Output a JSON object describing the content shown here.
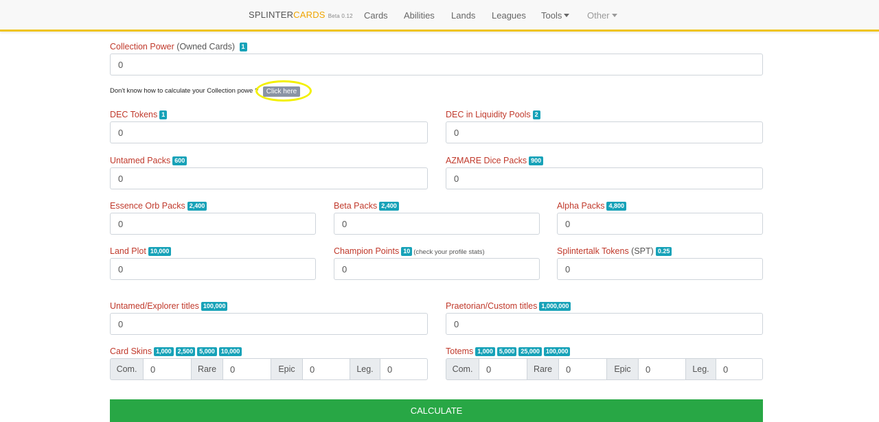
{
  "navbar": {
    "brand_part1": "SPLINTER",
    "brand_part2": "CARDS",
    "brand_beta": "Beta 0.12",
    "items": [
      "Cards",
      "Abilities",
      "Lands",
      "Leagues",
      "Tools",
      "Other"
    ]
  },
  "collection_power": {
    "label": "Collection Power",
    "sub": "(Owned Cards)",
    "badge": "1",
    "value": "0"
  },
  "help": {
    "text": "Don't know how to calculate your Collection powe",
    "mark": "?",
    "button": "Click here"
  },
  "dec_tokens": {
    "label": "DEC Tokens",
    "badge": "1",
    "value": "0"
  },
  "dec_liquidity": {
    "label": "DEC in Liquidity Pools",
    "badge": "2",
    "value": "0"
  },
  "untamed_packs": {
    "label": "Untamed Packs",
    "badge": "600",
    "value": "0"
  },
  "azmare_packs": {
    "label": "AZMARE Dice Packs",
    "badge": "900",
    "value": "0"
  },
  "essence_packs": {
    "label": "Essence Orb Packs",
    "badge": "2,400",
    "value": "0"
  },
  "beta_packs": {
    "label": "Beta Packs",
    "badge": "2,400",
    "value": "0"
  },
  "alpha_packs": {
    "label": "Alpha Packs",
    "badge": "4,800",
    "value": "0"
  },
  "land_plot": {
    "label": "Land Plot",
    "badge": "10,000",
    "value": "0"
  },
  "champion_points": {
    "label": "Champion Points",
    "badge": "10",
    "hint": "(check your profile stats)",
    "value": "0"
  },
  "spt": {
    "label": "Splintertalk Tokens",
    "sub": "(SPT)",
    "badge": "0.25",
    "value": "0"
  },
  "untamed_titles": {
    "label": "Untamed/Explorer titles",
    "badge": "100,000",
    "value": "0"
  },
  "praetorian_titles": {
    "label": "Praetorian/Custom titles",
    "badge": "1,000,000",
    "value": "0"
  },
  "card_skins": {
    "label": "Card Skins",
    "badges": [
      "1,000",
      "2,500",
      "5,000",
      "10,000"
    ],
    "addons": [
      "Com.",
      "Rare",
      "Epic",
      "Leg."
    ],
    "values": [
      "0",
      "0",
      "0",
      "0"
    ]
  },
  "totems": {
    "label": "Totems",
    "badges": [
      "1,000",
      "5,000",
      "25,000",
      "100,000"
    ],
    "addons": [
      "Com.",
      "Rare",
      "Epic",
      "Leg."
    ],
    "values": [
      "0",
      "0",
      "0",
      "0"
    ]
  },
  "calculate_button": "CALCULATE"
}
